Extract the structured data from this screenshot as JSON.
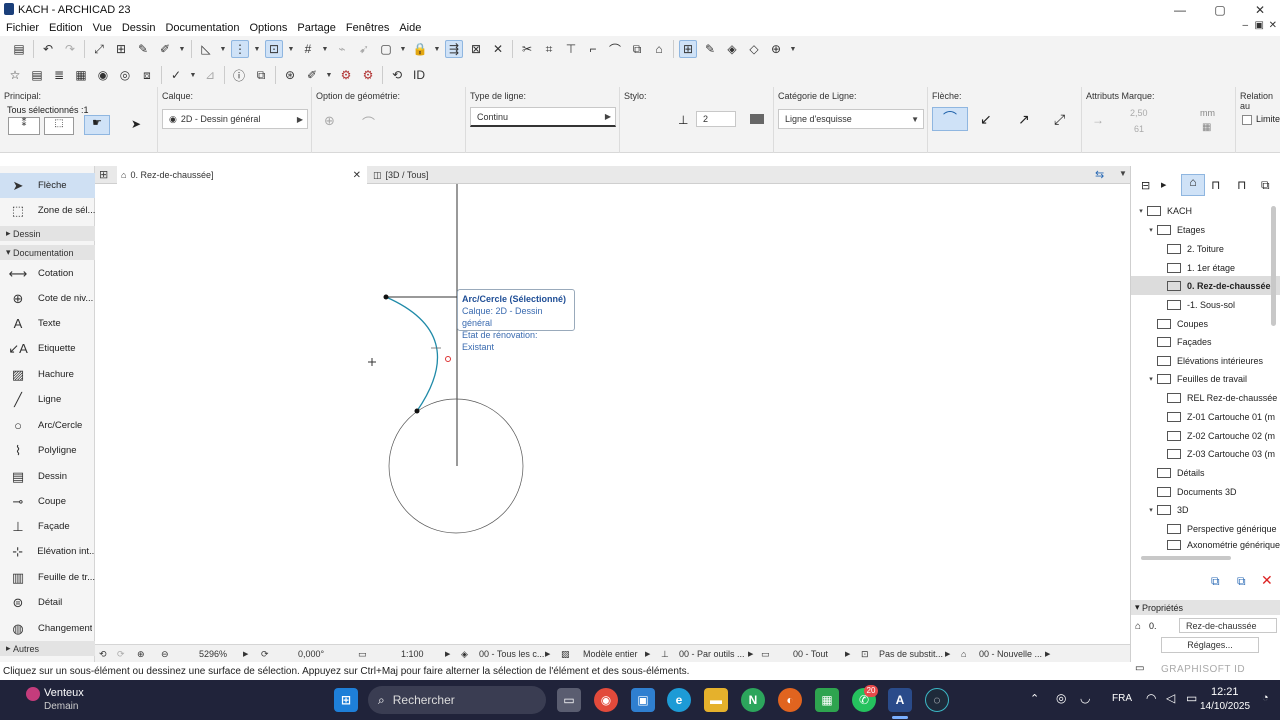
{
  "window": {
    "title": "KACH - ARCHICAD 23",
    "minimize": "—",
    "maximize": "▢",
    "close": "✕"
  },
  "menu": [
    "Fichier",
    "Edition",
    "Vue",
    "Dessin",
    "Documentation",
    "Options",
    "Partage",
    "Fenêtres",
    "Aide"
  ],
  "infobox": {
    "principal_label": "Principal:",
    "selection_info": "Tous sélectionnés :1",
    "layer_label": "Calque:",
    "layer_value": "2D - Dessin général",
    "geometry_label": "Option de géométrie:",
    "linetype_label": "Type de ligne:",
    "linetype_value": "Continu",
    "style_label": "Stylo:",
    "pen_value": "2",
    "linecat_label": "Catégorie de Ligne:",
    "linecat_value": "Ligne d'esquisse",
    "arrow_label": "Flèche:",
    "marker_label": "Attributs Marque:",
    "marker_size": "2,50",
    "marker_unit": "mm",
    "marker_pen": "61",
    "relation_label": "Relation au",
    "limit_label": "Limite"
  },
  "tabs": {
    "plan": "0. Rez-de-chaussée]",
    "view3d": "[3D / Tous]"
  },
  "toolbox": {
    "arrow": "Flèche",
    "marquee": "Zone de sél...",
    "group_dessin": "Dessin",
    "group_documentation": "Documentation",
    "tools": [
      "Cotation",
      "Cote de niv...",
      "Texte",
      "Etiquette",
      "Hachure",
      "Ligne",
      "Arc/Cercle",
      "Polyligne",
      "Dessin",
      "Coupe",
      "Façade",
      "Elévation int...",
      "Feuille de tr...",
      "Détail",
      "Changement"
    ],
    "group_autres": "Autres"
  },
  "tooltip": {
    "title": "Arc/Cercle (Sélectionné)",
    "line1": "Calque: 2D - Dessin général",
    "line2": "Etat de rénovation: Existant"
  },
  "bottombar": {
    "zoom": "5296%",
    "angle": "0,000°",
    "scale": "1:100",
    "layers": "00 - Tous les c...",
    "model": "Modèle entier",
    "pens": "00 - Par outils ...",
    "struct": "00 - Tout",
    "override": "Pas de substit...",
    "renovation": "00 - Nouvelle ..."
  },
  "status": "Cliquez sur un sous-élément ou dessinez une surface de sélection. Appuyez sur Ctrl+Maj pour faire alterner la sélection de l'élément et des sous-éléments.",
  "navigator": {
    "project": "KACH",
    "stories_label": "Etages",
    "stories": [
      "2. Toiture",
      "1. 1er étage",
      "0. Rez-de-chaussée",
      "-1. Sous-sol"
    ],
    "sections": "Coupes",
    "elevations": "Façades",
    "interior": "Elévations intérieures",
    "worksheets": "Feuilles de travail",
    "worksheet_items": [
      "REL Rez-de-chaussée",
      "Z-01 Cartouche 01 (m",
      "Z-02 Cartouche 02 (m",
      "Z-03 Cartouche 03 (m"
    ],
    "details": "Détails",
    "docs3d": "Documents 3D",
    "view3d": "3D",
    "view3d_items": [
      "Perspective générique",
      "Axonométrie générique"
    ]
  },
  "properties": {
    "label": "Propriétés",
    "id": "0.",
    "name": "Rez-de-chaussée",
    "settings": "Réglages...",
    "brand": "GRAPHISOFT ID"
  },
  "taskbar": {
    "weather": "Venteux",
    "weather_sub": "Demain",
    "search": "Rechercher",
    "lang": "FRA",
    "time": "12:21",
    "date": "14/10/2025",
    "whatsapp_badge": "20"
  }
}
